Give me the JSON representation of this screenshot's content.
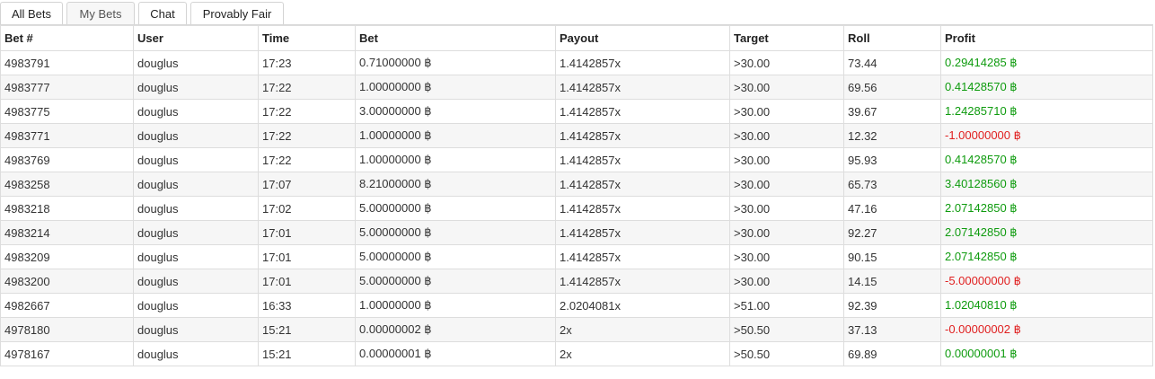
{
  "tabs": [
    {
      "label": "All Bets",
      "active": false
    },
    {
      "label": "My Bets",
      "active": true
    },
    {
      "label": "Chat",
      "active": false
    },
    {
      "label": "Provably Fair",
      "active": false
    }
  ],
  "table": {
    "columns": [
      "Bet #",
      "User",
      "Time",
      "Bet",
      "Payout",
      "Target",
      "Roll",
      "Profit"
    ],
    "rows": [
      {
        "bet_id": "4983791",
        "user": "douglus",
        "time": "17:23",
        "bet": "0.71000000 ฿",
        "payout": "1.4142857x",
        "target": ">30.00",
        "roll": "73.44",
        "profit": "0.29414285 ฿",
        "win": true
      },
      {
        "bet_id": "4983777",
        "user": "douglus",
        "time": "17:22",
        "bet": "1.00000000 ฿",
        "payout": "1.4142857x",
        "target": ">30.00",
        "roll": "69.56",
        "profit": "0.41428570 ฿",
        "win": true
      },
      {
        "bet_id": "4983775",
        "user": "douglus",
        "time": "17:22",
        "bet": "3.00000000 ฿",
        "payout": "1.4142857x",
        "target": ">30.00",
        "roll": "39.67",
        "profit": "1.24285710 ฿",
        "win": true
      },
      {
        "bet_id": "4983771",
        "user": "douglus",
        "time": "17:22",
        "bet": "1.00000000 ฿",
        "payout": "1.4142857x",
        "target": ">30.00",
        "roll": "12.32",
        "profit": "-1.00000000 ฿",
        "win": false
      },
      {
        "bet_id": "4983769",
        "user": "douglus",
        "time": "17:22",
        "bet": "1.00000000 ฿",
        "payout": "1.4142857x",
        "target": ">30.00",
        "roll": "95.93",
        "profit": "0.41428570 ฿",
        "win": true
      },
      {
        "bet_id": "4983258",
        "user": "douglus",
        "time": "17:07",
        "bet": "8.21000000 ฿",
        "payout": "1.4142857x",
        "target": ">30.00",
        "roll": "65.73",
        "profit": "3.40128560 ฿",
        "win": true
      },
      {
        "bet_id": "4983218",
        "user": "douglus",
        "time": "17:02",
        "bet": "5.00000000 ฿",
        "payout": "1.4142857x",
        "target": ">30.00",
        "roll": "47.16",
        "profit": "2.07142850 ฿",
        "win": true
      },
      {
        "bet_id": "4983214",
        "user": "douglus",
        "time": "17:01",
        "bet": "5.00000000 ฿",
        "payout": "1.4142857x",
        "target": ">30.00",
        "roll": "92.27",
        "profit": "2.07142850 ฿",
        "win": true
      },
      {
        "bet_id": "4983209",
        "user": "douglus",
        "time": "17:01",
        "bet": "5.00000000 ฿",
        "payout": "1.4142857x",
        "target": ">30.00",
        "roll": "90.15",
        "profit": "2.07142850 ฿",
        "win": true
      },
      {
        "bet_id": "4983200",
        "user": "douglus",
        "time": "17:01",
        "bet": "5.00000000 ฿",
        "payout": "1.4142857x",
        "target": ">30.00",
        "roll": "14.15",
        "profit": "-5.00000000 ฿",
        "win": false
      },
      {
        "bet_id": "4982667",
        "user": "douglus",
        "time": "16:33",
        "bet": "1.00000000 ฿",
        "payout": "2.0204081x",
        "target": ">51.00",
        "roll": "92.39",
        "profit": "1.02040810 ฿",
        "win": true
      },
      {
        "bet_id": "4978180",
        "user": "douglus",
        "time": "15:21",
        "bet": "0.00000002 ฿",
        "payout": "2x",
        "target": ">50.50",
        "roll": "37.13",
        "profit": "-0.00000002 ฿",
        "win": false
      },
      {
        "bet_id": "4978167",
        "user": "douglus",
        "time": "15:21",
        "bet": "0.00000001 ฿",
        "payout": "2x",
        "target": ">50.50",
        "roll": "69.89",
        "profit": "0.00000001 ฿",
        "win": true
      }
    ]
  },
  "colors": {
    "win": "#0e9b0e",
    "loss": "#e02020"
  }
}
